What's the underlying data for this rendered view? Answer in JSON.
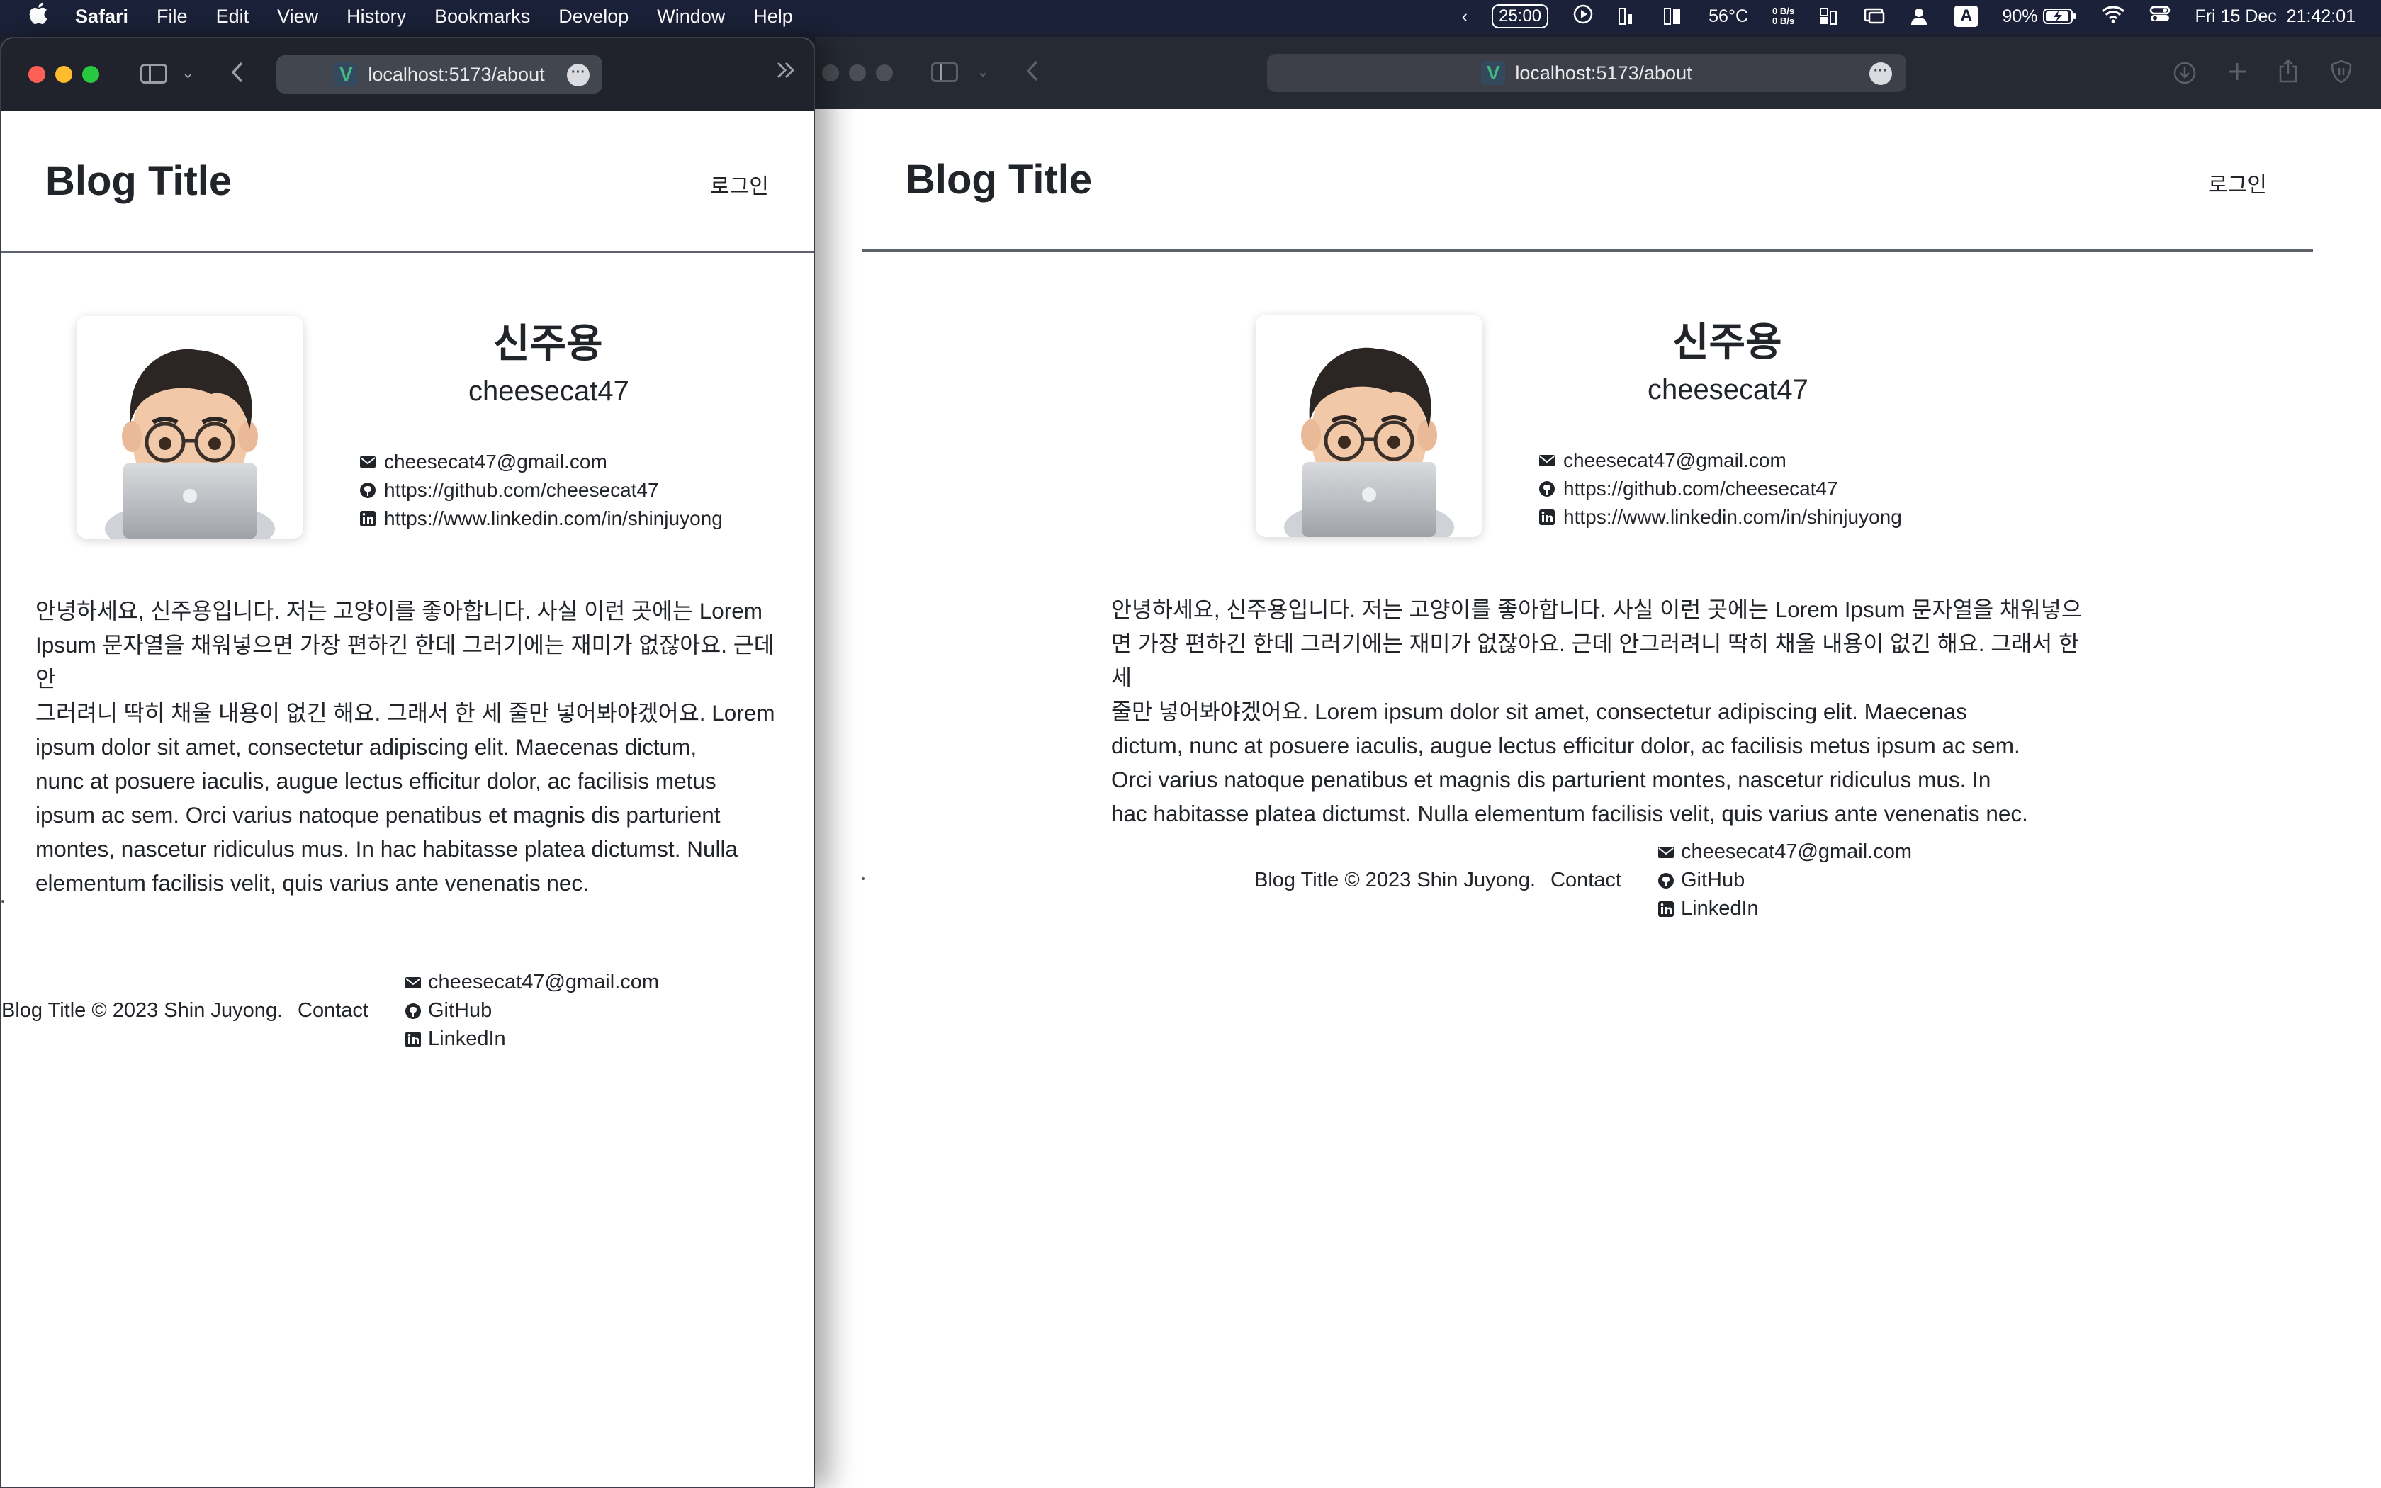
{
  "menubar": {
    "app": "Safari",
    "items": [
      "File",
      "Edit",
      "View",
      "History",
      "Bookmarks",
      "Develop",
      "Window",
      "Help"
    ],
    "timer": "25:00",
    "temperature": "56°C",
    "network": [
      "0 B/s",
      "0 B/s"
    ],
    "input_source": "A",
    "battery": "90%",
    "datetime": "Fri 15 Dec  21:42:01"
  },
  "windows": [
    {
      "url": "localhost:5173/about"
    },
    {
      "url": "localhost:5173/about"
    }
  ],
  "page": {
    "blog_title": "Blog Title",
    "login": "로그인",
    "profile": {
      "name": "신주용",
      "username": "cheesecat47",
      "email": "cheesecat47@gmail.com",
      "github": "https://github.com/cheesecat47",
      "linkedin": "https://www.linkedin.com/in/shinjuyong"
    },
    "bio_left": [
      "안녕하세요, 신주용입니다. 저는 고양이를 좋아합니다. 사실 이런 곳에는 Lorem",
      "Ipsum 문자열을 채워넣으면 가장 편하긴 한데 그러기에는 재미가 없잖아요. 근데 안",
      "그러려니 딱히 채울 내용이 없긴 해요. 그래서 한 세 줄만 넣어봐야겠어요. Lorem",
      "ipsum dolor sit amet, consectetur adipiscing elit. Maecenas dictum,",
      "nunc at posuere iaculis, augue lectus efficitur dolor, ac facilisis metus",
      "ipsum ac sem. Orci varius natoque penatibus et magnis dis parturient",
      "montes, nascetur ridiculus mus. In hac habitasse platea dictumst. Nulla",
      "elementum facilisis velit, quis varius ante venenatis nec."
    ],
    "bio_right": [
      "안녕하세요, 신주용입니다. 저는 고양이를 좋아합니다. 사실 이런 곳에는 Lorem Ipsum 문자열을 채워넣으",
      "면 가장 편하긴 한데 그러기에는 재미가 없잖아요. 근데 안그러려니 딱히 채울 내용이 없긴 해요. 그래서 한 세",
      "줄만 넣어봐야겠어요. Lorem ipsum dolor sit amet, consectetur adipiscing elit. Maecenas",
      "dictum, nunc at posuere iaculis, augue lectus efficitur dolor, ac facilisis metus ipsum ac sem.",
      "Orci varius natoque penatibus et magnis dis parturient montes, nascetur ridiculus mus. In",
      "hac habitasse platea dictumst. Nulla elementum facilisis velit, quis varius ante venenatis nec."
    ],
    "footer": {
      "copyright": "Blog Title © 2023 Shin Juyong.",
      "contact": "Contact",
      "email": "cheesecat47@gmail.com",
      "github": "GitHub",
      "linkedin": "LinkedIn"
    }
  },
  "colors": {
    "menubar_bg": "#1a2138",
    "toolbar_bg": "#20232b",
    "text": "#212529",
    "rule": "#5e6369",
    "vue_green": "#42b883"
  }
}
